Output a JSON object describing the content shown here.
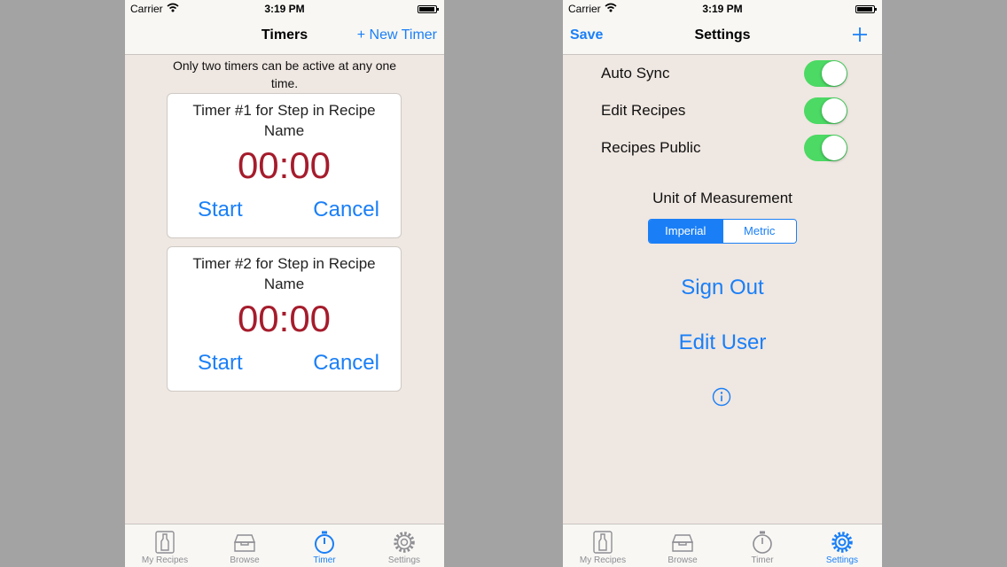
{
  "status_bar": {
    "carrier": "Carrier",
    "time": "3:19 PM"
  },
  "colors": {
    "accent": "#1a7ff7",
    "timer_digits": "#a51c2c",
    "toggle_on": "#4cd964",
    "background": "#efe7e1"
  },
  "timers_screen": {
    "nav": {
      "title": "Timers",
      "right_button": "+ New Timer"
    },
    "info": "Only two timers can be active at any one time.",
    "timers": [
      {
        "title": "Timer #1 for Step in Recipe Name",
        "time": "00:00",
        "start": "Start",
        "cancel": "Cancel"
      },
      {
        "title": "Timer #2 for Step in Recipe Name",
        "time": "00:00",
        "start": "Start",
        "cancel": "Cancel"
      }
    ],
    "tabs": [
      {
        "label": "My Recipes",
        "icon": "bottle-icon",
        "active": false
      },
      {
        "label": "Browse",
        "icon": "drawer-icon",
        "active": false
      },
      {
        "label": "Timer",
        "icon": "stopwatch-icon",
        "active": true
      },
      {
        "label": "Settings",
        "icon": "gear-icon",
        "active": false
      }
    ]
  },
  "settings_screen": {
    "nav": {
      "left_button": "Save",
      "title": "Settings",
      "right_icon": "plus-icon"
    },
    "toggles": [
      {
        "label": "Auto Sync",
        "on": true
      },
      {
        "label": "Edit Recipes",
        "on": true
      },
      {
        "label": "Recipes Public",
        "on": true
      }
    ],
    "unit_label": "Unit of Measurement",
    "unit_options": [
      "Imperial",
      "Metric"
    ],
    "unit_selected": "Imperial",
    "sign_out": "Sign Out",
    "edit_user": "Edit User",
    "info_icon": "info-icon",
    "tabs": [
      {
        "label": "My Recipes",
        "icon": "bottle-icon",
        "active": false
      },
      {
        "label": "Browse",
        "icon": "drawer-icon",
        "active": false
      },
      {
        "label": "Timer",
        "icon": "stopwatch-icon",
        "active": false
      },
      {
        "label": "Settings",
        "icon": "gear-icon",
        "active": true
      }
    ]
  }
}
